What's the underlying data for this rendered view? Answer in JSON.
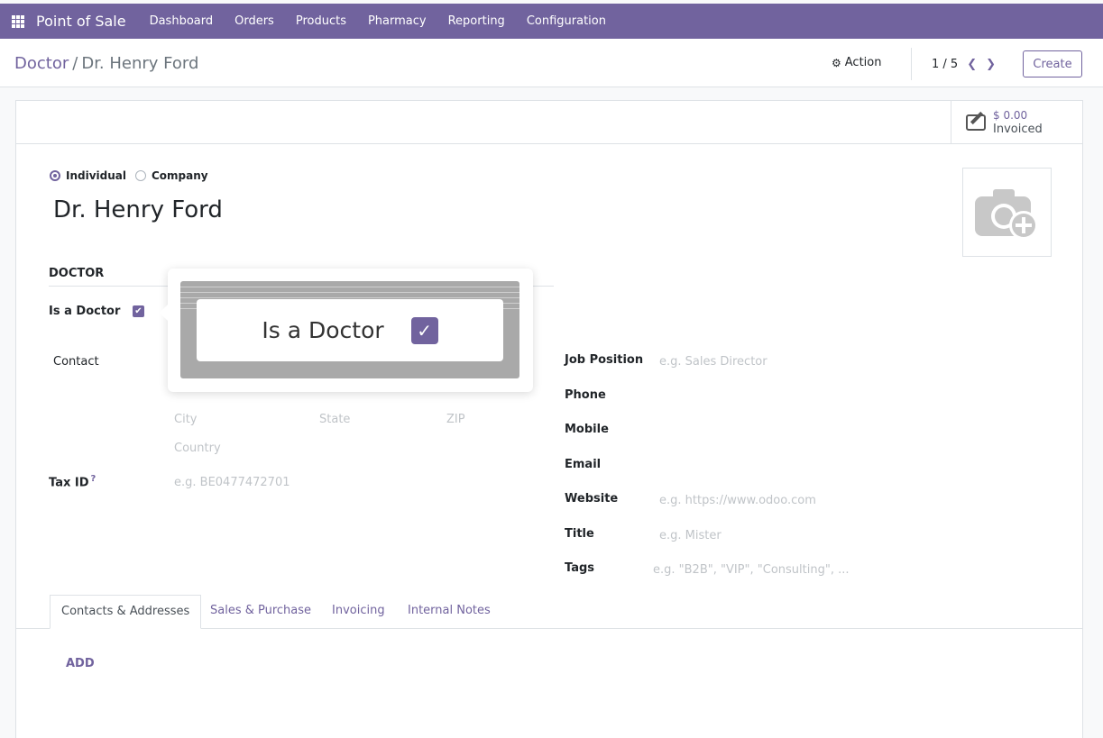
{
  "navbar": {
    "brand": "Point of Sale",
    "menu": [
      "Dashboard",
      "Orders",
      "Products",
      "Pharmacy",
      "Reporting",
      "Configuration"
    ]
  },
  "breadcrumb": {
    "parent": "Doctor",
    "current": "Dr. Henry Ford"
  },
  "control": {
    "action_label": "Action",
    "pager": "1 / 5",
    "create_label": "Create"
  },
  "stat": {
    "amount": "$ 0.00",
    "label": "Invoiced"
  },
  "partner_type": {
    "individual": "Individual",
    "company": "Company",
    "selected": "Individual"
  },
  "partner_name": "Dr. Henry Ford",
  "doctor_section": {
    "title": "DOCTOR",
    "is_doctor_label": "Is a Doctor",
    "is_doctor_checked": true
  },
  "left_fields": {
    "contact_label": "Contact",
    "city_placeholder": "City",
    "state_placeholder": "State",
    "zip_placeholder": "ZIP",
    "country_placeholder": "Country",
    "tax_id_label": "Tax ID",
    "tax_id_help": "?",
    "tax_id_placeholder": "e.g. BE0477472701"
  },
  "right_fields": {
    "job_position_label": "Job Position",
    "job_position_placeholder": "e.g. Sales Director",
    "phone_label": "Phone",
    "mobile_label": "Mobile",
    "email_label": "Email",
    "website_label": "Website",
    "website_placeholder": "e.g. https://www.odoo.com",
    "title_label": "Title",
    "title_placeholder": "e.g. Mister",
    "tags_label": "Tags",
    "tags_placeholder": "e.g. \"B2B\", \"VIP\", \"Consulting\", ..."
  },
  "tabs": [
    "Contacts & Addresses",
    "Sales & Purchase",
    "Invoicing",
    "Internal Notes"
  ],
  "add_label": "ADD",
  "popup": {
    "zoom_label": "Is a Doctor",
    "zoom_checked": true
  },
  "colors": {
    "brand": "#71639e",
    "navbar": "#71639e"
  }
}
